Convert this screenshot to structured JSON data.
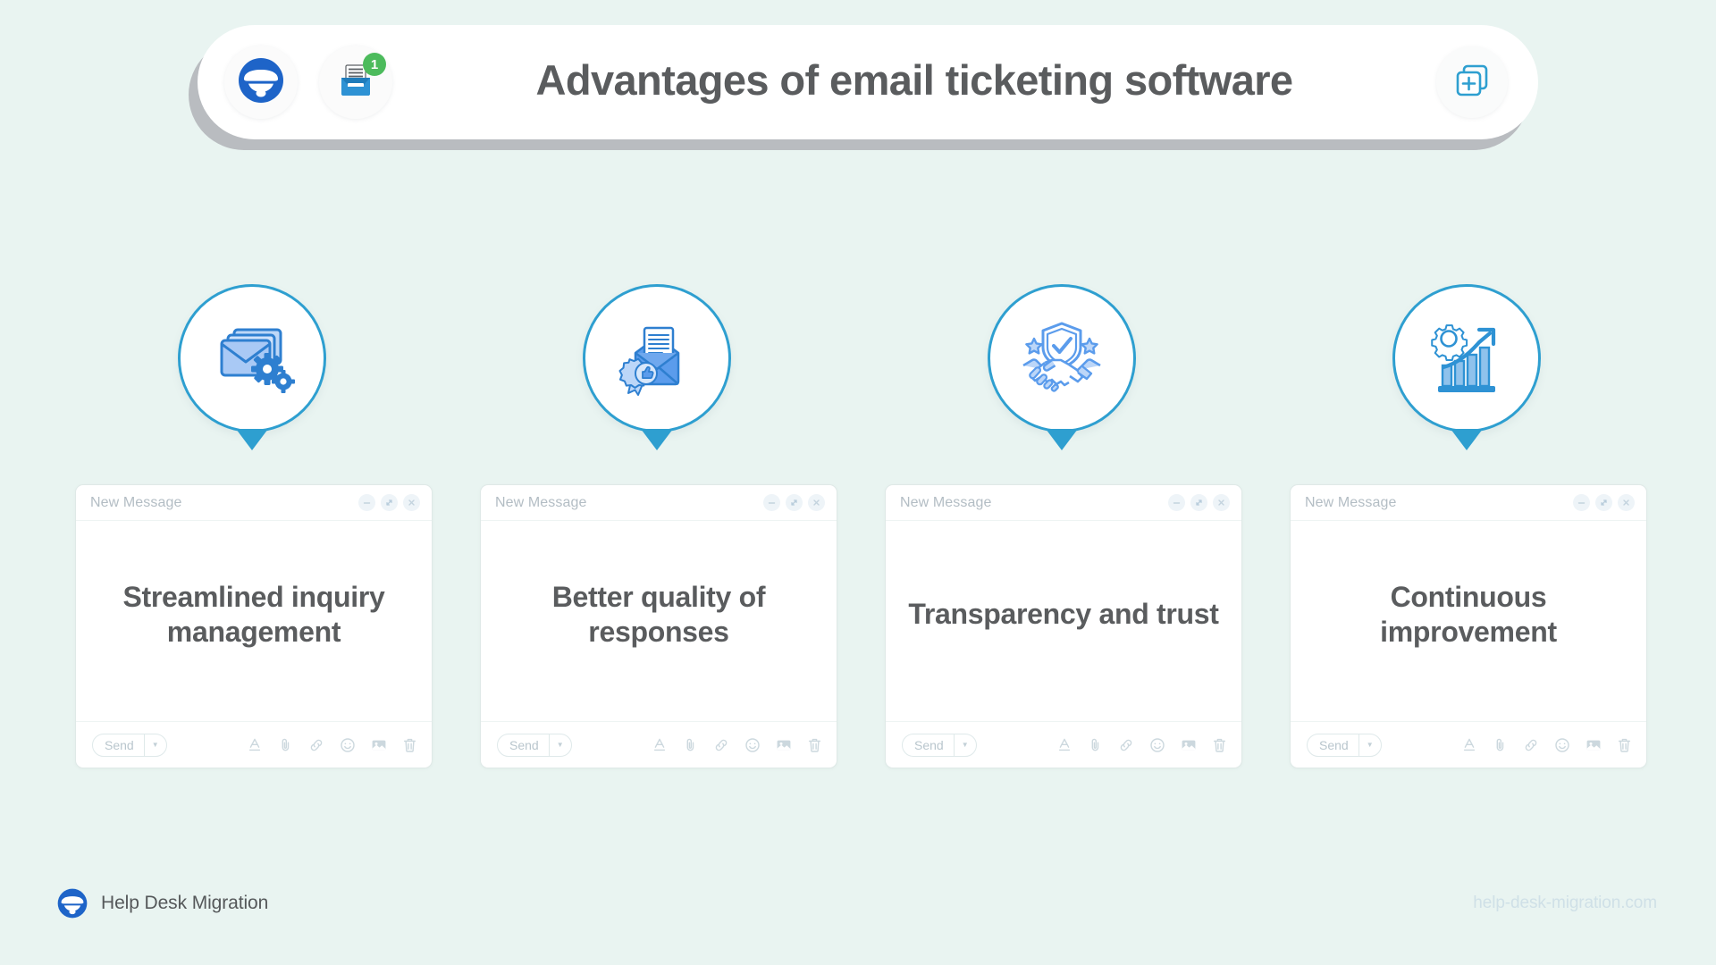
{
  "background_color": "#e9f4f1",
  "accent_color": "#2e9fd0",
  "header": {
    "title": "Advantages of email ticketing software",
    "logo_icon": "help-desk-migration-logo-icon",
    "inbox_icon": "inbox-tray-icon",
    "inbox_badge_count": "1",
    "badge_color": "#4cbb5c",
    "add_icon": "add-duplicate-page-icon"
  },
  "columns": [
    {
      "icon": "envelope-with-gears-icon",
      "card": {
        "window_title": "New Message",
        "heading": "Streamlined inquiry management",
        "send_label": "Send"
      }
    },
    {
      "icon": "open-envelope-quality-badge-icon",
      "card": {
        "window_title": "New Message",
        "heading": "Better quality of responses",
        "send_label": "Send"
      }
    },
    {
      "icon": "handshake-shield-stars-icon",
      "card": {
        "window_title": "New Message",
        "heading": "Transparency and trust",
        "send_label": "Send"
      }
    },
    {
      "icon": "growth-chart-gear-icon",
      "card": {
        "window_title": "New Message",
        "heading": "Continuous improvement",
        "send_label": "Send"
      }
    }
  ],
  "window_controls": [
    "minimize-icon",
    "expand-icon",
    "close-icon"
  ],
  "toolbar_icons": [
    "text-format-icon",
    "attachment-icon",
    "link-icon",
    "emoji-icon",
    "image-icon",
    "trash-icon"
  ],
  "footer": {
    "brand": "Help Desk Migration",
    "logo_icon": "help-desk-migration-logo-icon",
    "url": "help-desk-migration.com"
  }
}
